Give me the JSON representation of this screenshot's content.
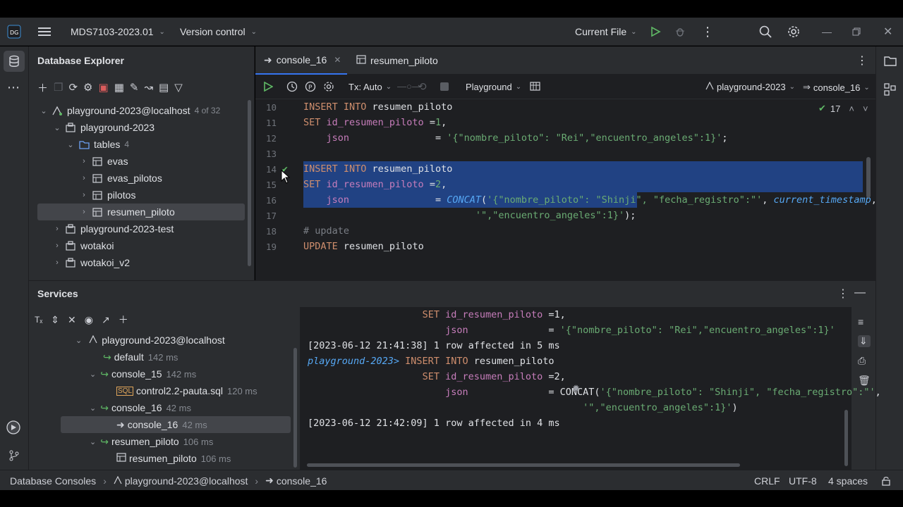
{
  "topbar": {
    "project": "MDS7103-2023.01",
    "vcs": "Version control",
    "run_config": "Current File"
  },
  "db_explorer": {
    "title": "Database Explorer",
    "tree": [
      {
        "label": "playground-2023@localhost",
        "count": "4 of 32"
      },
      {
        "label": "playground-2023"
      },
      {
        "label": "tables",
        "count": "4"
      },
      {
        "label": "evas"
      },
      {
        "label": "evas_pilotos"
      },
      {
        "label": "pilotos"
      },
      {
        "label": "resumen_piloto"
      },
      {
        "label": "playground-2023-test"
      },
      {
        "label": "wotakoi"
      },
      {
        "label": "wotakoi_v2"
      }
    ]
  },
  "editor": {
    "tabs": [
      "console_16",
      "resumen_piloto"
    ],
    "toolbar": {
      "tx": "Tx: Auto",
      "schema": "Playground",
      "datasource": "playground-2023",
      "console": "console_16"
    },
    "inspections_count": "17",
    "lines": [
      {
        "n": "10",
        "segs": [
          [
            "kw",
            "INSERT INTO "
          ],
          [
            "",
            "resumen_piloto"
          ]
        ]
      },
      {
        "n": "11",
        "segs": [
          [
            "kw",
            "SET "
          ],
          [
            "col",
            "id_resumen_piloto"
          ],
          [
            "",
            " ="
          ],
          [
            "str",
            "1"
          ],
          [
            "",
            ","
          ]
        ]
      },
      {
        "n": "12",
        "segs": [
          [
            "",
            ""
          ],
          [
            "col",
            "    json"
          ],
          [
            "",
            "               = "
          ],
          [
            "str",
            "'{\"nombre_piloto\": \"Rei\",\"encuentro_angeles\":1}'"
          ],
          [
            "",
            ";"
          ]
        ]
      },
      {
        "n": "13",
        "segs": [
          [
            "",
            ""
          ]
        ]
      },
      {
        "n": "14",
        "segs": [
          [
            "kw",
            "INSERT INTO "
          ],
          [
            "",
            "resumen_piloto"
          ]
        ]
      },
      {
        "n": "15",
        "segs": [
          [
            "kw",
            "SET "
          ],
          [
            "col",
            "id_resumen_piloto"
          ],
          [
            "",
            " ="
          ],
          [
            "str",
            "2"
          ],
          [
            "",
            ","
          ]
        ]
      },
      {
        "n": "16",
        "segs": [
          [
            "col",
            "    json"
          ],
          [
            "",
            "               = "
          ],
          [
            "fn",
            "CONCAT"
          ],
          [
            "",
            "("
          ],
          [
            "str",
            "'{\"nombre_piloto\": \"Shinji\", \"fecha_registro\":\"'"
          ],
          [
            "",
            ", "
          ],
          [
            "fn",
            "current_timestamp"
          ],
          [
            "",
            ","
          ]
        ]
      },
      {
        "n": "17",
        "segs": [
          [
            "",
            "                              "
          ],
          [
            "str",
            "'\",\"encuentro_angeles\":1}'"
          ],
          [
            "",
            ");"
          ]
        ]
      },
      {
        "n": "18",
        "segs": [
          [
            "cm",
            "# update"
          ]
        ]
      },
      {
        "n": "19",
        "segs": [
          [
            "kw",
            "UPDATE "
          ],
          [
            "",
            "resumen_piloto"
          ]
        ]
      }
    ]
  },
  "services": {
    "title": "Services",
    "tree": [
      {
        "label": "playground-2023@localhost",
        "ms": ""
      },
      {
        "label": "default",
        "ms": "142 ms"
      },
      {
        "label": "console_15",
        "ms": "142 ms"
      },
      {
        "label": "control2.2-pauta.sql",
        "ms": "120 ms"
      },
      {
        "label": "console_16",
        "ms": "42 ms"
      },
      {
        "label": "console_16",
        "ms": "42 ms"
      },
      {
        "label": "resumen_piloto",
        "ms": "106 ms"
      },
      {
        "label": "resumen_piloto",
        "ms": "106 ms"
      }
    ],
    "output": [
      {
        "segs": [
          [
            "",
            "                    "
          ],
          [
            "kw",
            "SET "
          ],
          [
            "col",
            "id_resumen_piloto"
          ],
          [
            "",
            " =1,"
          ]
        ]
      },
      {
        "segs": [
          [
            "",
            "                        "
          ],
          [
            "col",
            "json"
          ],
          [
            "",
            "              = "
          ],
          [
            "str",
            "'{\"nombre_piloto\": \"Rei\",\"encuentro_angeles\":1}'"
          ]
        ]
      },
      {
        "segs": [
          [
            "",
            "[2023-06-12 21:41:38] 1 row affected in 5 ms"
          ]
        ]
      },
      {
        "segs": [
          [
            "fn",
            "playground-2023> "
          ],
          [
            "kw",
            "INSERT INTO "
          ],
          [
            "",
            "resumen_piloto"
          ]
        ]
      },
      {
        "segs": [
          [
            "",
            "                    "
          ],
          [
            "kw",
            "SET "
          ],
          [
            "col",
            "id_resumen_piloto"
          ],
          [
            "",
            " =2,"
          ]
        ]
      },
      {
        "segs": [
          [
            "",
            "                        "
          ],
          [
            "col",
            "json"
          ],
          [
            "",
            "              = CONCAT("
          ],
          [
            "str",
            "'{\"nombre_piloto\": \"Shinji\", \"fecha_registro\":\"'"
          ],
          [
            "",
            ","
          ]
        ]
      },
      {
        "segs": [
          [
            "",
            "                                                "
          ],
          [
            "str",
            "'\",\"encuentro_angeles\":1}'"
          ],
          [
            "",
            ")"
          ]
        ]
      },
      {
        "segs": [
          [
            "",
            "[2023-06-12 21:42:09] 1 row affected in 4 ms"
          ]
        ]
      }
    ]
  },
  "statusbar": {
    "crumbs": [
      "Database Consoles",
      "playground-2023@localhost",
      "console_16"
    ],
    "line_sep": "CRLF",
    "encoding": "UTF-8",
    "indent": "4 spaces"
  }
}
